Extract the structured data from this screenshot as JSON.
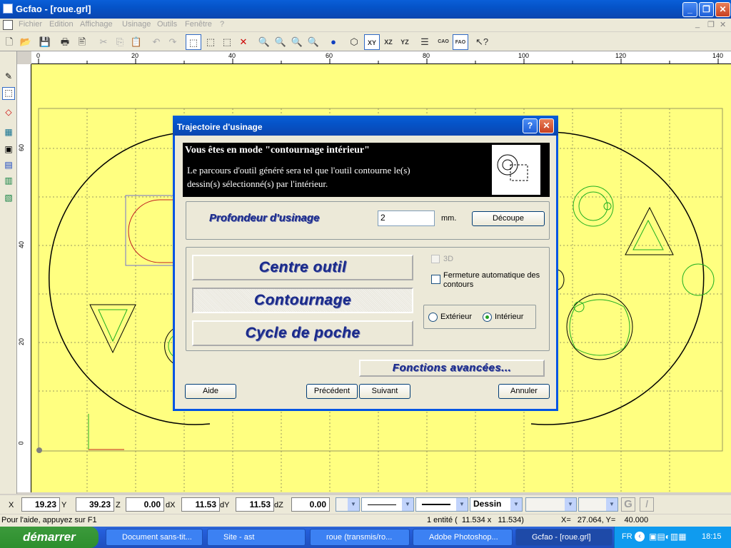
{
  "window": {
    "title": "Gcfao - [roue.grl]"
  },
  "menu": [
    "Fichier",
    "Edition",
    "Affichage",
    "Usinage",
    "Outils",
    "Fenêtre",
    "?"
  ],
  "toolbar": {
    "xy": "XY",
    "xz": "XZ",
    "yz": "YZ",
    "cao": "CAO",
    "fao": "FAO"
  },
  "ruler_h": [
    "0",
    "20",
    "40",
    "60",
    "80",
    "100",
    "120",
    "140"
  ],
  "ruler_v": [
    "60",
    "40",
    "20",
    "0"
  ],
  "dialog": {
    "title": "Trajectoire d'usinage",
    "header": "Vous êtes en mode \"contournage intérieur\"",
    "desc1": "Le parcours d'outil généré sera tel que l'outil contourne le(s)",
    "desc2": "dessin(s) sélectionné(s) par l'intérieur.",
    "profondeur_label": "Profondeur d'usinage",
    "profondeur_value": "2",
    "unit": "mm.",
    "decoupe": "Découpe",
    "centre_outil": "Centre outil",
    "contournage": "Contournage",
    "cycle_poche": "Cycle de poche",
    "opt_3d": "3D",
    "fermeture": "Fermeture automatique des contours",
    "exterieur": "Extérieur",
    "interieur": "Intérieur",
    "fonctions": "Fonctions avancées...",
    "aide": "Aide",
    "precedent": "Précédent",
    "suivant": "Suivant",
    "annuler": "Annuler"
  },
  "coords": {
    "x_label": "X",
    "x_val": "19.23",
    "y_label": "Y",
    "y_val": "39.23",
    "z_label": "Z",
    "z_val": "0.00",
    "dx_label": "dX",
    "dx_val": "11.53",
    "dy_label": "dY",
    "dy_val": "11.53",
    "dz_label": "dZ",
    "dz_val": "0.00",
    "layer": "Dessin"
  },
  "status": {
    "help": "Pour l'aide, appuyez sur F1",
    "entity": "1 entité (  11.534 x   11.534)",
    "pos": "X=   27.064, Y=    40.000"
  },
  "taskbar": {
    "start": "démarrer",
    "tasks": [
      "Document sans-tit...",
      "Site - ast",
      "roue (transmis/ro...",
      "Adobe Photoshop...",
      "Gcfao - [roue.grl]"
    ],
    "lang": "FR",
    "clock": "18:15"
  }
}
